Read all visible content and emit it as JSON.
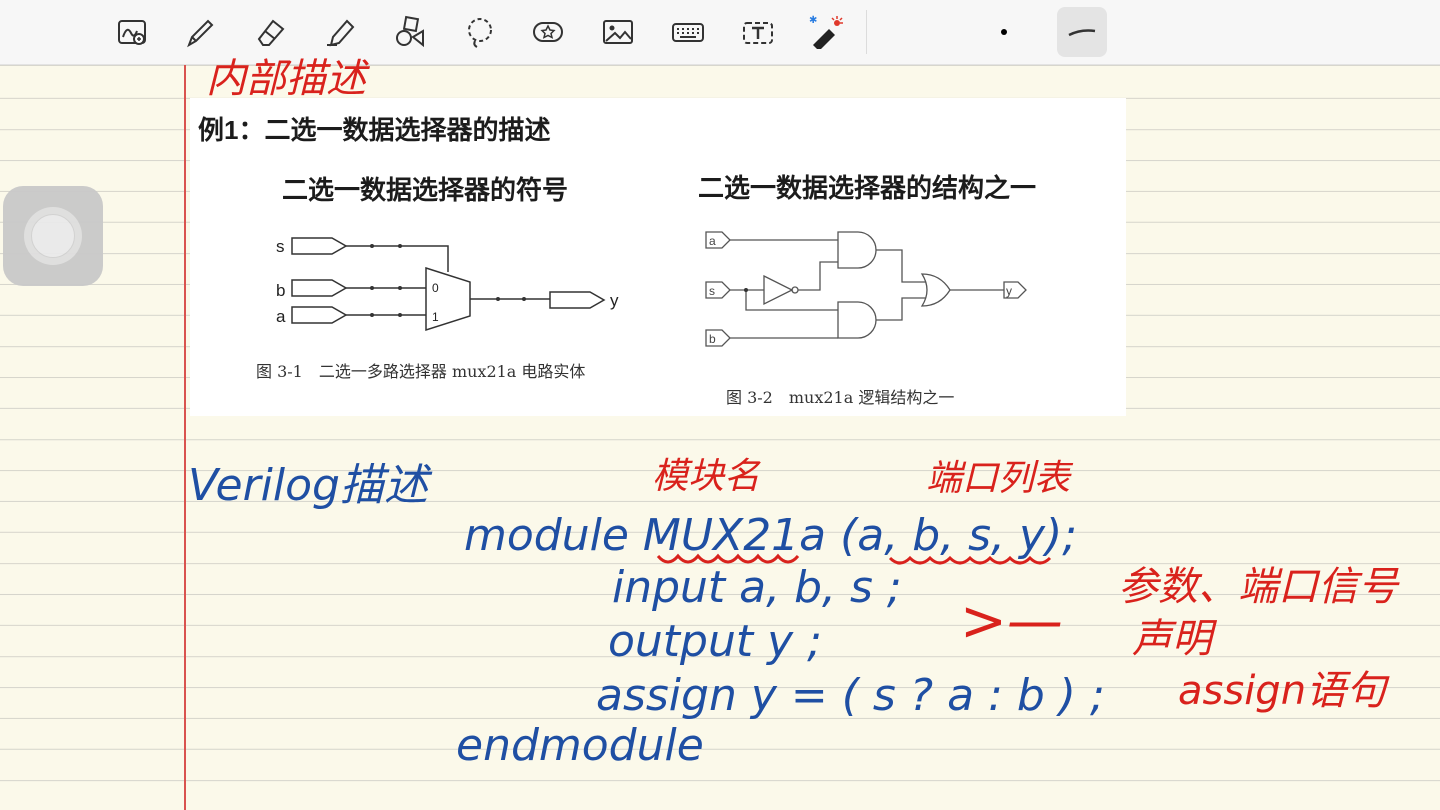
{
  "toolbar": {
    "tools": [
      "lasso-handwriting-icon",
      "pen-icon",
      "eraser-icon",
      "highlighter-icon",
      "shapes-icon",
      "lasso-select-icon",
      "sticker-icon",
      "image-icon",
      "keyboard-icon",
      "text-icon",
      "laser-pointer-icon"
    ],
    "color_dot": "#000000",
    "stroke_preview": "stroke-width-icon"
  },
  "colors": {
    "ink_blue": "#1f4fa3",
    "ink_red": "#d9221c",
    "margin": "#d9534f"
  },
  "figure": {
    "example_title": "例1：二选一数据选择器的描述",
    "left_subtitle": "二选一数据选择器的符号",
    "right_subtitle": "二选一数据选择器的结构之一",
    "left_caption": "图 3-1　二选一多路选择器 mux21a 电路实体",
    "right_caption": "图 3-2　mux21a 逻辑结构之一",
    "left_pins": [
      "s",
      "b",
      "a"
    ],
    "mux_inputs": [
      "0",
      "1"
    ],
    "left_output": "y",
    "right_pins": [
      "a",
      "s",
      "b"
    ],
    "right_output": "y"
  },
  "notes": {
    "top_partial": "内部描述",
    "verilog_heading": "Verilog描述",
    "label_module_name": "模块名",
    "label_port_list": "端口列表",
    "code_line1": "module  MUX21a  (a, b, s, y);",
    "code_line2": "input  a, b, s ;",
    "code_line3": "output  y ;",
    "code_line4": "assign  y = ( s ? a : b ) ;",
    "code_line5": "endmodule",
    "annotation_params": "参数、端口信号",
    "annotation_declare": "声明",
    "annotation_assign": "assign语句",
    "arrow": ">—"
  }
}
